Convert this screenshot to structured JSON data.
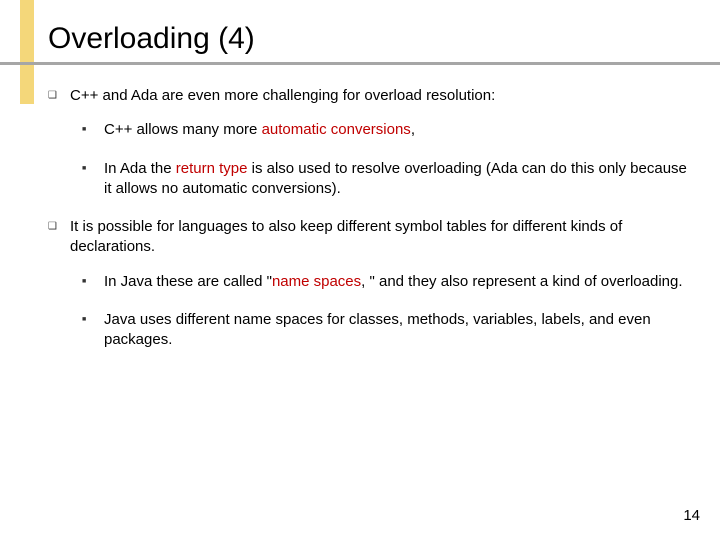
{
  "title": "Overloading (4)",
  "bullets": {
    "p1": "C++ and Ada are even more challenging for overload resolution:",
    "p1a_pre": "C++ allows many more ",
    "p1a_hl": "automatic conversions",
    "p1a_post": ",",
    "p1b_pre": "In Ada the ",
    "p1b_hl": "return type",
    "p1b_post": " is also used to resolve overloading (Ada can do this only because it allows no automatic conversions).",
    "p2": "It is possible for languages to also keep different symbol tables for different kinds of declarations.",
    "p2a_pre": "In Java these are called \"",
    "p2a_hl": "name spaces",
    "p2a_post": ", \" and they also represent a kind of overloading.",
    "p2b": "Java uses different name spaces for classes, methods, variables, labels, and even packages."
  },
  "page": "14"
}
